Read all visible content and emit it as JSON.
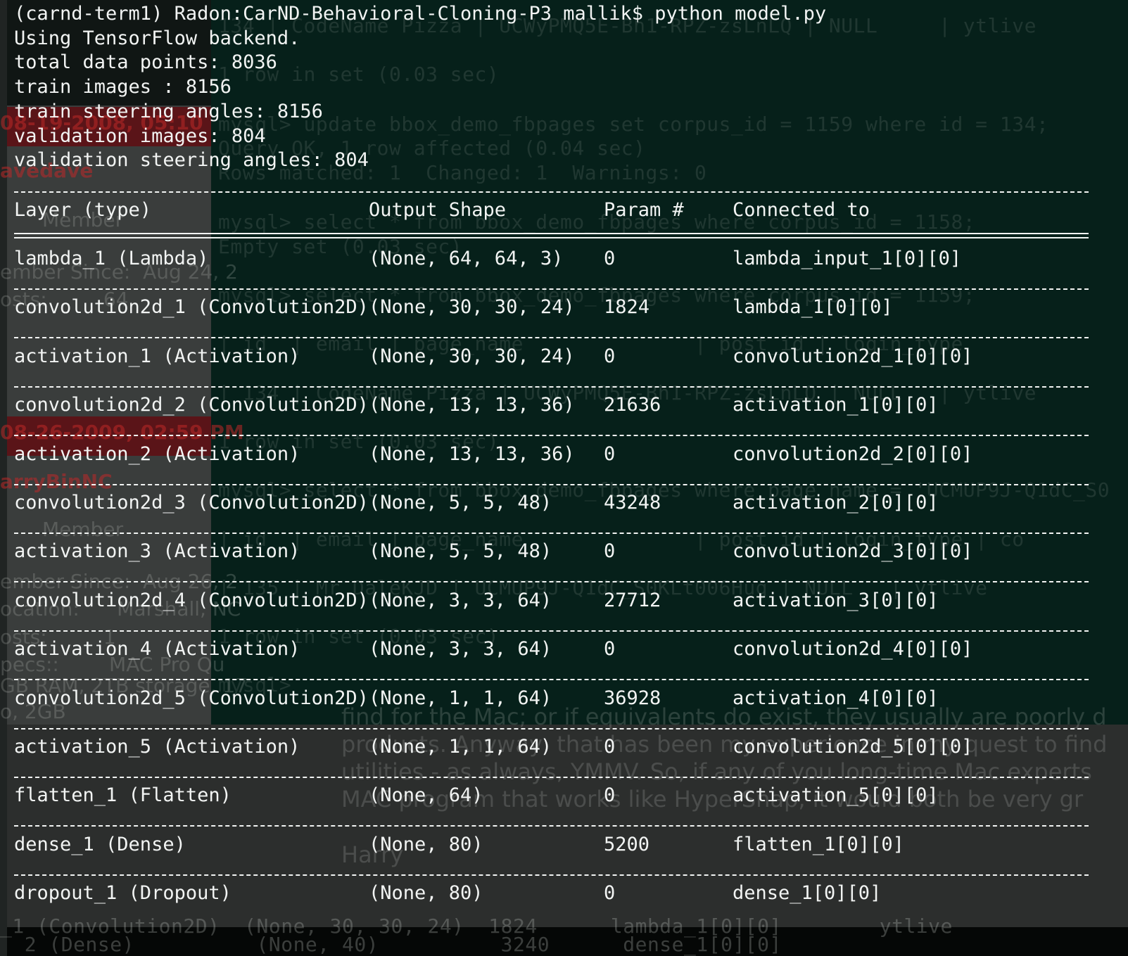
{
  "background_ghost": {
    "right_lines": [
      "134 | CodeName Pizza | UCWyPMQ5E-Bh1-RPZ-zsLnLQ | NULL     | ytlive",
      "1 row in set (0.03 sec)",
      "mysql> update bbox_demo_fbpages set corpus_id = 1159 where id = 134;",
      "Query OK, 1 row affected (0.04 sec)",
      "Rows matched: 1  Changed: 1  Warnings: 0",
      "mysql> select * from bbox_demo_fbpages where corpus_id = 1158;",
      "Empty set (0.03 sec)",
      "mysql> select * from bbox_demo_fbpages where corpus_id = 1159;",
      "| id  | email | page_name              | post_id | login_type",
      "| 134 | CodeName Pizza | UCWyPMQ5E-Bh1-RPZ-zsLnLQ | NULL   | ytlive",
      "1 row in set (0.03 sec)",
      "mysql> select * from bbox_demo_fbpages where page_name = 'UCMUP9J-Q1dC_S0",
      "| id  | email | page_name              | post_id | login_type | co",
      "| 135 | Mr DaleKJD | UCMUP9J-Q1dC_S0KLt006Hug | NULL   | ytlive",
      "1 row in set (0.03 sec)",
      "mysql>"
    ],
    "left_lines": [
      "08-19-2008, 05:10",
      "avedave",
      "Member",
      "ember Since:  Aug 24, 2",
      "osts:         64",
      "08-26-2009, 02:59 PM",
      "arryBinNC",
      "Member",
      "ember Since:  Aug 26, 2",
      "ocation:      Marshall, NC",
      "osts:         1",
      "pecs::        MAC Pro Qu",
      "GB RAM, 2TB storage, 17",
      "o, 2GB"
    ],
    "forum_lines": [
      "find for the Mac; or if equivalents do exist, they usually are poorly d",
      "products. Anyway, that has been my experience in my quest to find",
      "utilities - as always, YMMV. So, if any of you long-time Mac experts",
      "MAC program that works like HyperSnap, it would both be very gr",
      "Harry"
    ],
    "bottom_lines": [
      "_1 (Convolution2D)  (None, 30, 30, 24)  1824      lambda_1[0][0]        ytlive",
      "  2 (Dense)          (None, 40)          3240      dense_1[0][0]"
    ]
  },
  "terminal": {
    "prompt_line": "(carnd-term1) Radon:CarND-Behavioral-Cloning-P3 mallik$ python model.py",
    "output_lines": [
      "Using TensorFlow backend.",
      "total data points: 8036",
      "train images : 8156",
      "train steering angles: 8156",
      "validation images: 804",
      "validation steering angles: 804"
    ],
    "table": {
      "headers": [
        "Layer (type)",
        "Output Shape",
        "Param #",
        "Connected to"
      ],
      "rows": [
        [
          "lambda_1 (Lambda)",
          "(None, 64, 64, 3)",
          "0",
          "lambda_input_1[0][0]"
        ],
        [
          "convolution2d_1 (Convolution2D)",
          "(None, 30, 30, 24)",
          "1824",
          "lambda_1[0][0]"
        ],
        [
          "activation_1 (Activation)",
          "(None, 30, 30, 24)",
          "0",
          "convolution2d_1[0][0]"
        ],
        [
          "convolution2d_2 (Convolution2D)",
          "(None, 13, 13, 36)",
          "21636",
          "activation_1[0][0]"
        ],
        [
          "activation_2 (Activation)",
          "(None, 13, 13, 36)",
          "0",
          "convolution2d_2[0][0]"
        ],
        [
          "convolution2d_3 (Convolution2D)",
          "(None, 5, 5, 48)",
          "43248",
          "activation_2[0][0]"
        ],
        [
          "activation_3 (Activation)",
          "(None, 5, 5, 48)",
          "0",
          "convolution2d_3[0][0]"
        ],
        [
          "convolution2d_4 (Convolution2D)",
          "(None, 3, 3, 64)",
          "27712",
          "activation_3[0][0]"
        ],
        [
          "activation_4 (Activation)",
          "(None, 3, 3, 64)",
          "0",
          "convolution2d_4[0][0]"
        ],
        [
          "convolution2d_5 (Convolution2D)",
          "(None, 1, 1, 64)",
          "36928",
          "activation_4[0][0]"
        ],
        [
          "activation_5 (Activation)",
          "(None, 1, 1, 64)",
          "0",
          "convolution2d_5[0][0]"
        ],
        [
          "flatten_1 (Flatten)",
          "(None, 64)",
          "0",
          "activation_5[0][0]"
        ],
        [
          "dense_1 (Dense)",
          "(None, 80)",
          "5200",
          "flatten_1[0][0]"
        ],
        [
          "dropout_1 (Dropout)",
          "(None, 80)",
          "0",
          "dense_1[0][0]"
        ]
      ]
    }
  },
  "colors": {
    "terminal_text": "#f2f4f3",
    "terminal_bg": "#06201a",
    "accent_red": "#5a1418"
  }
}
